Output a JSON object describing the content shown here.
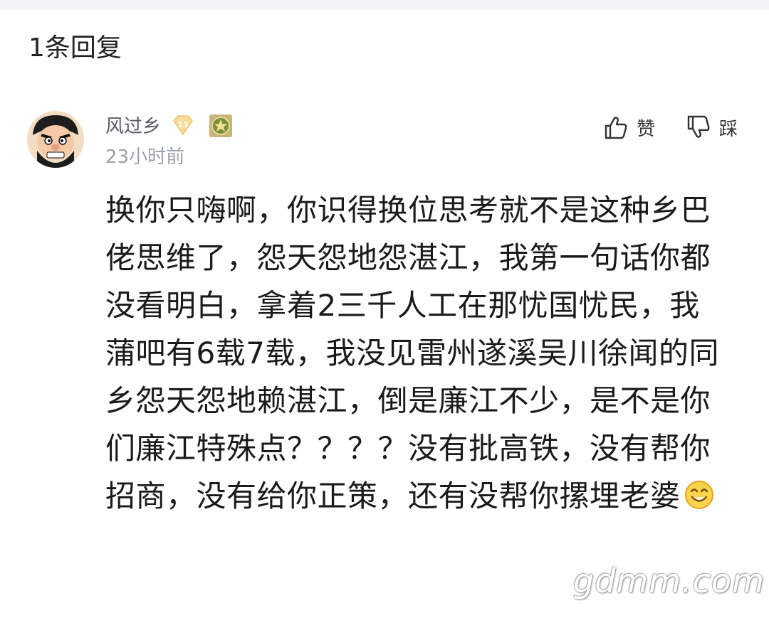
{
  "header": {
    "reply_count_label": "1条回复"
  },
  "comment": {
    "username": "风过乡",
    "level": "13",
    "timestamp": "23小时前",
    "like_label": "赞",
    "dislike_label": "踩",
    "text": "换你只嗨啊，你识得换位思考就不是这种乡巴佬思维了，怨天怨地怨湛江，我第一句话你都没看明白，拿着2三千人工在那忧国忧民，我蒲吧有6载7载，我没见雷州遂溪吴川徐闻的同乡怨天怨地赖湛江，倒是廉江不少，是不是你们廉江特殊点？？？？没有批高铁，没有帮你招商，没有给你正策，还有没帮你摞埋老婆"
  },
  "watermark": "gdmm.com",
  "colors": {
    "level_badge": "#f0c36a",
    "icon_stroke": "#333333",
    "timestamp": "#9aa0a8"
  },
  "icons": [
    "thumbs-up-icon",
    "thumbs-down-icon",
    "smile-emoji-icon",
    "medal-icon"
  ]
}
